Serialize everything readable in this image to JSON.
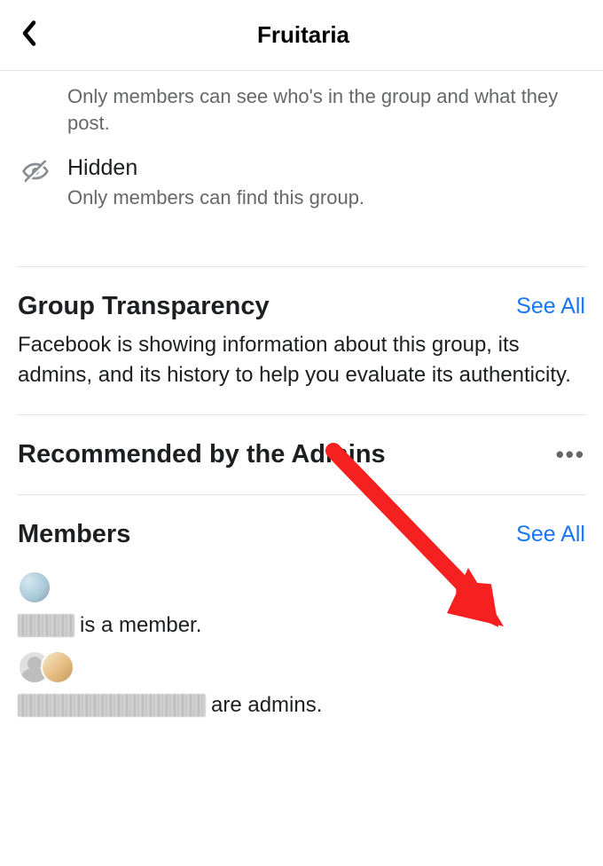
{
  "header": {
    "title": "Fruitaria"
  },
  "privacy": {
    "first_desc": "Only members can see who's in the group and what they post.",
    "hidden_title": "Hidden",
    "hidden_desc": "Only members can find this group."
  },
  "transparency": {
    "heading": "Group Transparency",
    "see_all": "See All",
    "body": "Facebook is showing information about this group, its admins, and its history to help you evaluate its authenticity."
  },
  "recommended": {
    "heading": "Recommended by the Admins"
  },
  "members": {
    "heading": "Members",
    "see_all": "See All",
    "row1_suffix": "is a member.",
    "row2_suffix": "are admins."
  }
}
